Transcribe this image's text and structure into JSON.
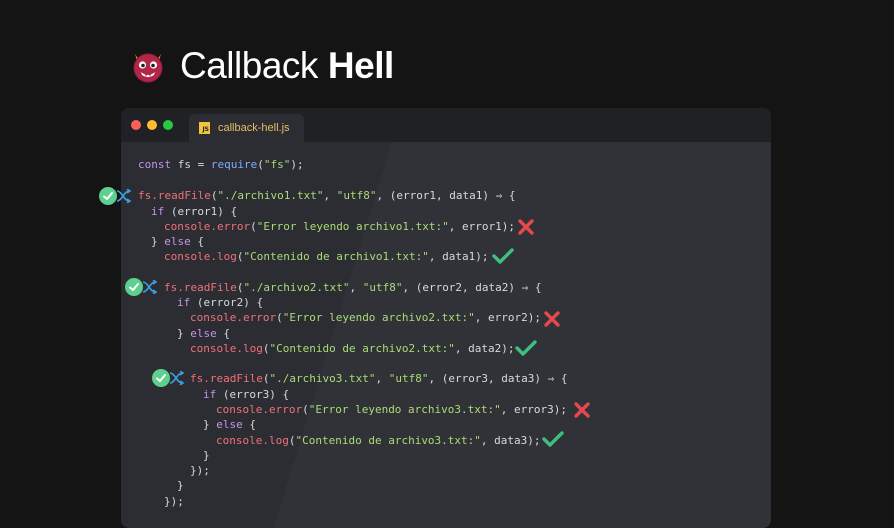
{
  "header": {
    "title_light": "Callback",
    "title_bold": "Hell",
    "logo_icon": "devil-emoji-icon"
  },
  "window": {
    "tab_label": "callback-hell.js",
    "file_icon": "js-file-icon",
    "traffic_lights": [
      "#ff5f57",
      "#febc2e",
      "#28c840"
    ]
  },
  "code": {
    "l1": {
      "a": "const",
      "b": " fs = ",
      "c": "require",
      "d": "(",
      "e": "\"fs\"",
      "f": ");"
    },
    "r1": {
      "call": "fs.readFile",
      "open": "(",
      "path": "\"./archivo1.txt\"",
      "sep1": ", ",
      "enc": "\"utf8\"",
      "rest": ", (error1, data1) ⇒ {"
    },
    "r1_if": {
      "kw": "if",
      "rest": " (error1) {"
    },
    "r1_err": {
      "call": "console.error",
      "open": "(",
      "msg": "\"Error leyendo archivo1.txt:\"",
      "rest": ", error1);"
    },
    "r1_else": {
      "a": "} ",
      "kw": "else",
      "b": " {"
    },
    "r1_log": {
      "call": "console.log",
      "open": "(",
      "msg": "\"Contenido de archivo1.txt:\"",
      "rest": ", data1);"
    },
    "r2": {
      "call": "fs.readFile",
      "open": "(",
      "path": "\"./archivo2.txt\"",
      "sep1": ", ",
      "enc": "\"utf8\"",
      "rest": ", (error2, data2) ⇒ {"
    },
    "r2_if": {
      "kw": "if",
      "rest": " (error2) {"
    },
    "r2_err": {
      "call": "console.error",
      "open": "(",
      "msg": "\"Error leyendo archivo2.txt:\"",
      "rest": ", error2);"
    },
    "r2_else": {
      "a": "} ",
      "kw": "else",
      "b": " {"
    },
    "r2_log": {
      "call": "console.log",
      "open": "(",
      "msg": "\"Contenido de archivo2.txt:\"",
      "rest": ", data2);"
    },
    "r3": {
      "call": "fs.readFile",
      "open": "(",
      "path": "\"./archivo3.txt\"",
      "sep1": ", ",
      "enc": "\"utf8\"",
      "rest": ", (error3, data3) ⇒ {"
    },
    "r3_if": {
      "kw": "if",
      "rest": " (error3) {"
    },
    "r3_err": {
      "call": "console.error",
      "open": "(",
      "msg": "\"Error leyendo archivo3.txt:\"",
      "rest": ", error3);"
    },
    "r3_else": {
      "a": "} ",
      "kw": "else",
      "b": " {"
    },
    "r3_log": {
      "call": "console.log",
      "open": "(",
      "msg": "\"Contenido de archivo3.txt:\"",
      "rest": ", data3);"
    },
    "close1": "}",
    "close2": "});",
    "close3": "}",
    "close4": "});"
  },
  "markers": {
    "branch_icon": "check-branch-icon",
    "error_icon": "cross-icon",
    "success_icon": "checkmark-icon",
    "colors": {
      "error": "#e5484d",
      "success": "#3fbf7f",
      "badge": "#5fcf8f",
      "branch": "#3b9ede"
    }
  }
}
